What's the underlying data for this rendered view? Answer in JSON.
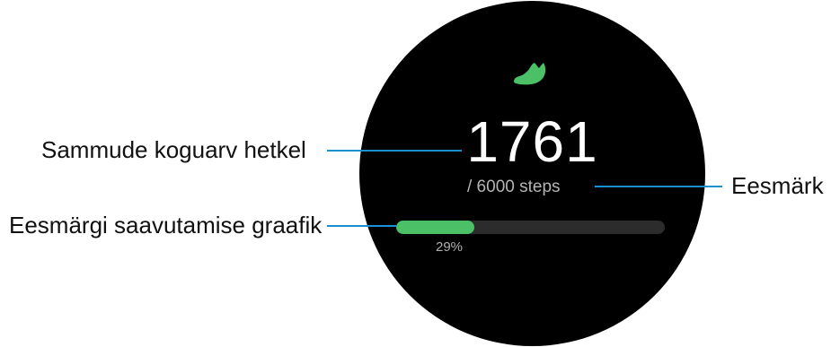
{
  "watch": {
    "step_count": "1761",
    "goal_text": "/ 6000 steps",
    "progress_fraction": 0.29,
    "progress_label": "29%",
    "shoe_icon": "shoe-icon",
    "accent_color": "#4cc067"
  },
  "callouts": {
    "current_steps": "Sammude koguarv hetkel",
    "goal": "Eesmärk",
    "progress_graph": "Eesmärgi saavutamise graafik",
    "line_color": "#1a8fd1"
  }
}
